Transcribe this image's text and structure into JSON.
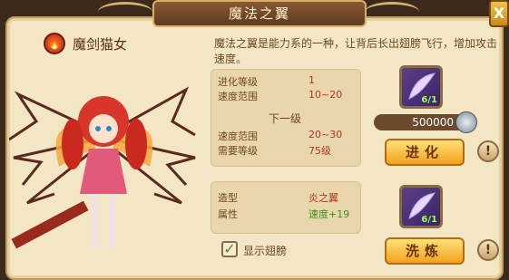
{
  "window": {
    "title": "魔法之翼",
    "close_label": "X"
  },
  "character": {
    "name": "魔剑猫女",
    "type_icon": "fire-emblem-icon"
  },
  "description": "魔法之翼是能力系的一种，让背后长出翅膀飞行，增加攻击速度。",
  "current": {
    "rows": [
      {
        "label": "进化等级",
        "value": "1"
      },
      {
        "label": "速度范围",
        "value": "10~20"
      }
    ]
  },
  "next": {
    "title": "下一级",
    "rows": [
      {
        "label": "速度范围",
        "value": "20~30"
      },
      {
        "label": "需要等级",
        "value": "75级"
      }
    ]
  },
  "evolve": {
    "item_count": "6/1",
    "cost": "500000",
    "button": "进化",
    "item_icon": "feather-wing-icon",
    "coin_icon": "silver-coin-icon"
  },
  "appearance": {
    "rows": [
      {
        "label": "造型",
        "value": "炎之翼"
      },
      {
        "label": "属性",
        "value": "速度+19"
      }
    ]
  },
  "refine": {
    "item_count": "6/1",
    "button": "洗炼",
    "item_icon": "feather-wing-icon"
  },
  "show_wings": {
    "label": "显示翅膀",
    "checked": true
  },
  "help_icon": "!",
  "colors": {
    "accent": "#f2a31a",
    "value_red": "#b2361a",
    "value_green": "#3e8e1e"
  }
}
